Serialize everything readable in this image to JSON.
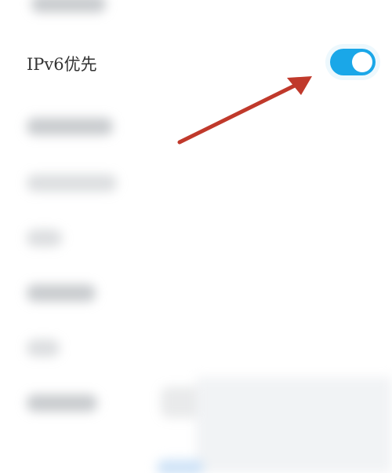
{
  "settings": {
    "ipv6_priority": {
      "label": "IPv6优先",
      "enabled": true
    }
  },
  "colors": {
    "toggle_on": "#1aa7e8",
    "annotation_arrow": "#c0392b",
    "label_text": "#333333"
  },
  "annotation": {
    "type": "arrow",
    "target": "ipv6-priority-toggle"
  }
}
